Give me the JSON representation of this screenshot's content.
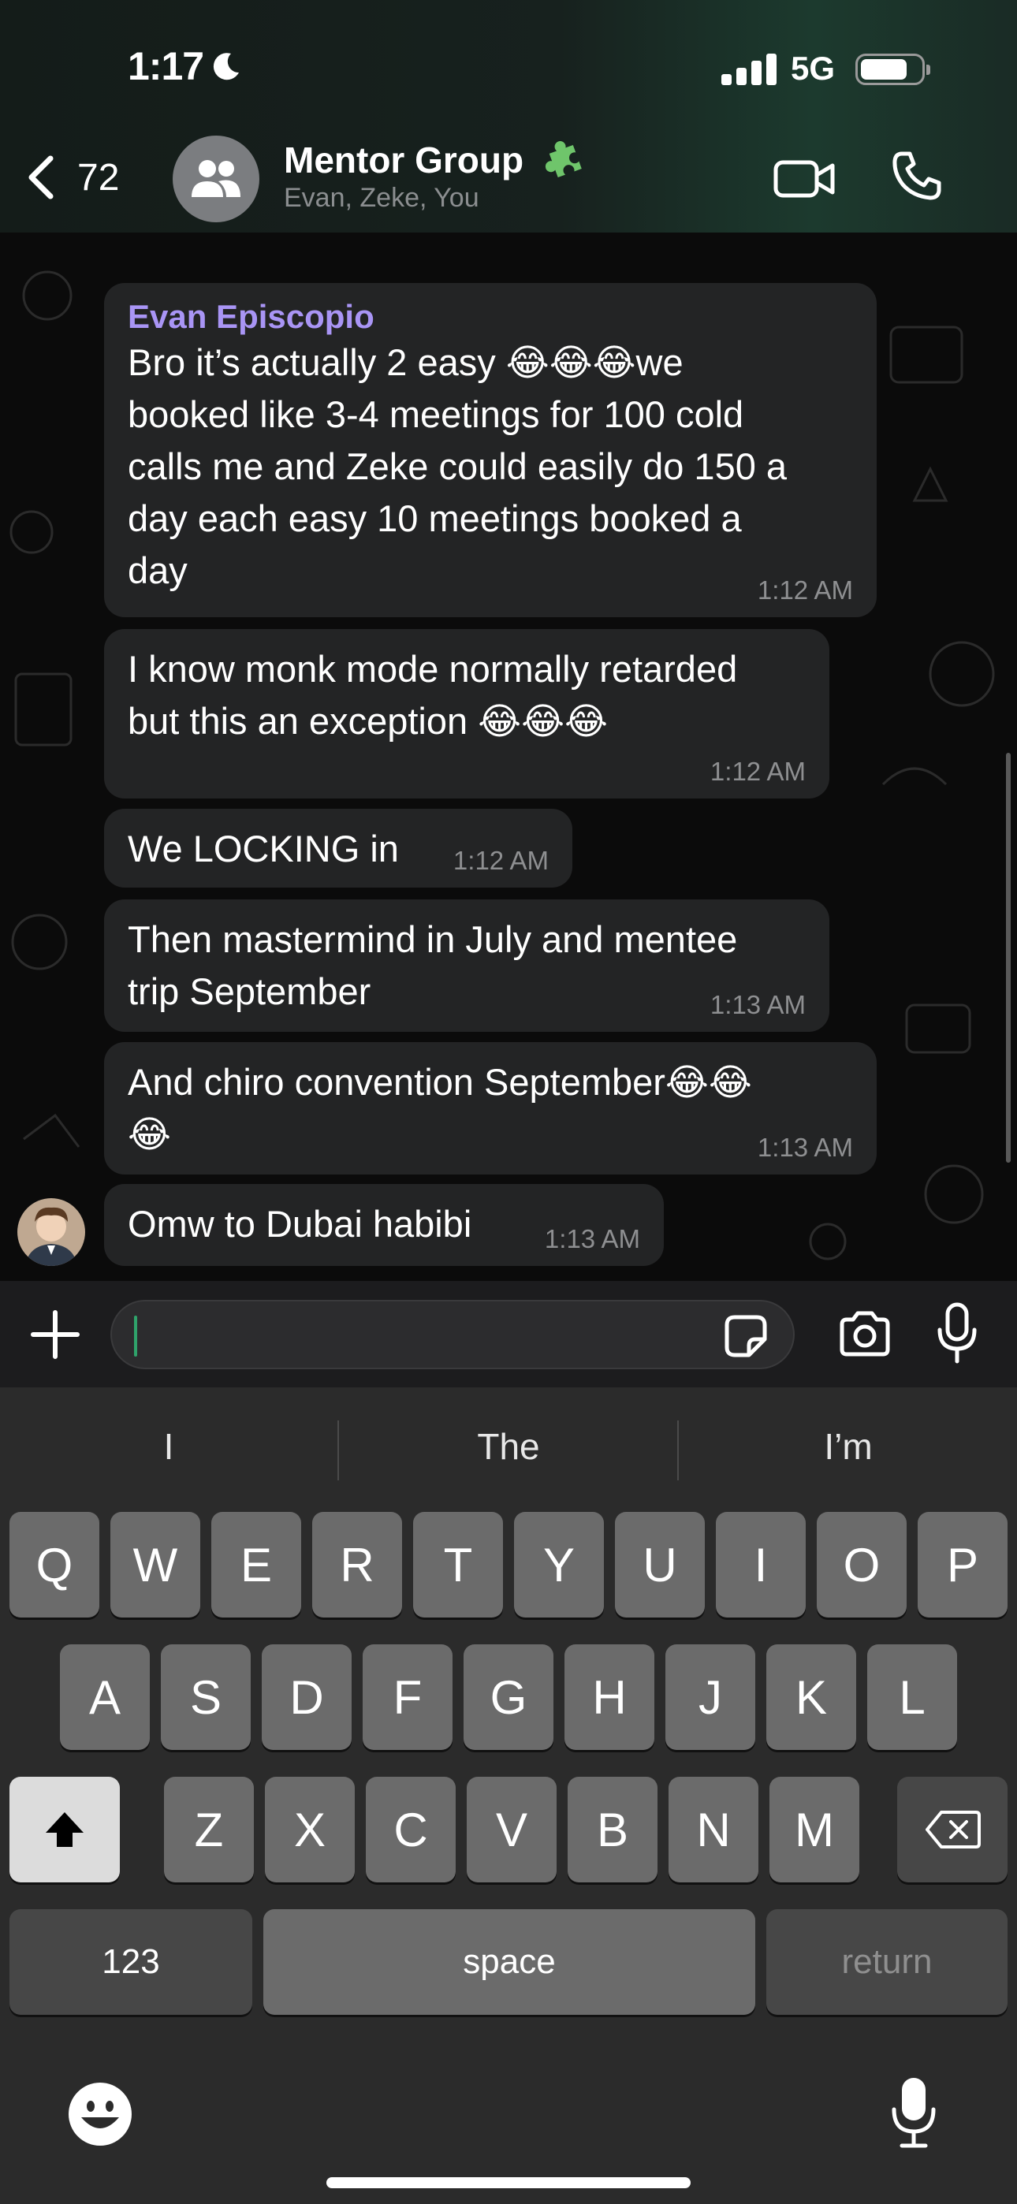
{
  "status_bar": {
    "time": "1:17",
    "network": "5G"
  },
  "header": {
    "back_count": "72",
    "group_name": "Mentor Group",
    "members": "Evan, Zeke, You"
  },
  "messages": [
    {
      "sender": "Evan Episcopio",
      "text": "Bro it’s actually 2 easy 😂😂😂we\nbooked like 3-4 meetings for 100 cold\ncalls me and Zeke could easily do 150 a\nday each easy 10 meetings booked a\nday",
      "time": "1:12 AM"
    },
    {
      "text": "I know monk mode normally retarded\nbut this an exception 😂😂😂",
      "time": "1:12 AM"
    },
    {
      "text": "We LOCKING in",
      "time": "1:12 AM"
    },
    {
      "text": "Then mastermind in July and mentee\ntrip September",
      "time": "1:13 AM"
    },
    {
      "text": "And chiro convention September😂😂\n😂",
      "time": "1:13 AM"
    },
    {
      "text": "Omw to Dubai habibi",
      "time": "1:13 AM"
    }
  ],
  "composer": {
    "input_value": "",
    "placeholder": ""
  },
  "keyboard": {
    "suggestions": [
      "I",
      "The",
      "I’m"
    ],
    "row1": [
      "Q",
      "W",
      "E",
      "R",
      "T",
      "Y",
      "U",
      "I",
      "O",
      "P"
    ],
    "row2": [
      "A",
      "S",
      "D",
      "F",
      "G",
      "H",
      "J",
      "K",
      "L"
    ],
    "row3": [
      "Z",
      "X",
      "C",
      "V",
      "B",
      "N",
      "M"
    ],
    "numbers_label": "123",
    "space_label": "space",
    "return_label": "return"
  },
  "colors": {
    "sender_name": "#a995f5",
    "bubble": "#232425",
    "caret": "#2fa36b"
  },
  "icons": [
    "moon-icon",
    "signal-icon",
    "battery-icon",
    "chevron-left-icon",
    "group-icon",
    "puzzle-icon",
    "video-call-icon",
    "phone-icon",
    "plus-icon",
    "sticker-icon",
    "camera-icon",
    "microphone-icon",
    "shift-icon",
    "delete-icon",
    "emoji-icon"
  ]
}
